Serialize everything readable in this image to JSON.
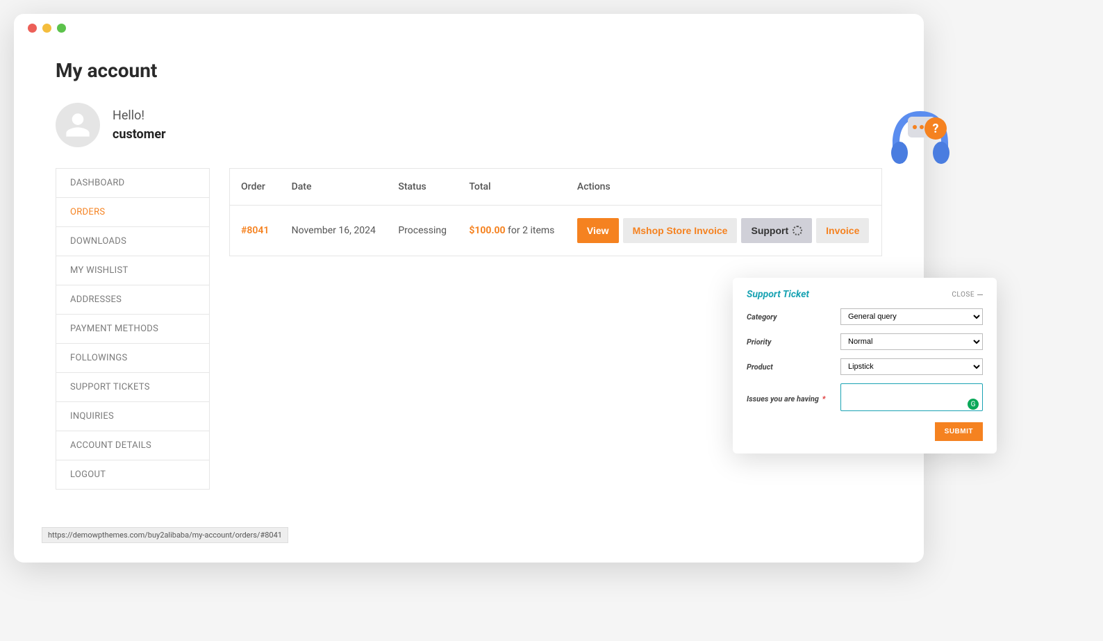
{
  "page_title": "My account",
  "greeting": {
    "hello": "Hello!",
    "username": "customer"
  },
  "sidebar": {
    "items": [
      {
        "label": "DASHBOARD",
        "active": false
      },
      {
        "label": "ORDERS",
        "active": true
      },
      {
        "label": "DOWNLOADS",
        "active": false
      },
      {
        "label": "MY WISHLIST",
        "active": false
      },
      {
        "label": "ADDRESSES",
        "active": false
      },
      {
        "label": "PAYMENT METHODS",
        "active": false
      },
      {
        "label": "FOLLOWINGS",
        "active": false
      },
      {
        "label": "SUPPORT TICKETS",
        "active": false
      },
      {
        "label": "INQUIRIES",
        "active": false
      },
      {
        "label": "ACCOUNT DETAILS",
        "active": false
      },
      {
        "label": "LOGOUT",
        "active": false
      }
    ]
  },
  "table": {
    "headers": {
      "order": "Order",
      "date": "Date",
      "status": "Status",
      "total": "Total",
      "actions": "Actions"
    },
    "rows": [
      {
        "id": "#8041",
        "date": "November 16, 2024",
        "status": "Processing",
        "price": "$100.00",
        "suffix": " for 2 items",
        "actions": {
          "view": "View",
          "invoice1": "Mshop Store Invoice",
          "support": "Support",
          "invoice2": "Invoice"
        }
      }
    ]
  },
  "popup": {
    "title": "Support Ticket",
    "close": "CLOSE",
    "labels": {
      "category": "Category",
      "priority": "Priority",
      "product": "Product",
      "issues": "Issues you are having"
    },
    "values": {
      "category": "General query",
      "priority": "Normal",
      "product": "Lipstick"
    },
    "submit": "SUBMIT"
  },
  "status_url": "https://demowpthemes.com/buy2alibaba/my-account/orders/#8041",
  "colors": {
    "accent": "#f58220",
    "teal": "#1aa3b3"
  }
}
